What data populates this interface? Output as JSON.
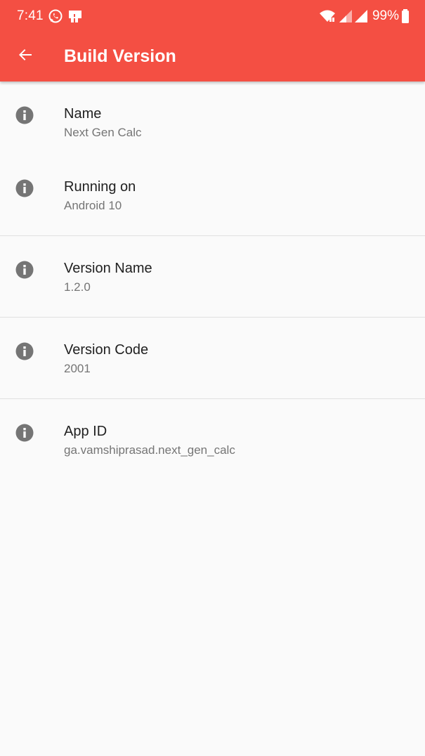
{
  "status_bar": {
    "time": "7:41",
    "battery": "99%",
    "icons": [
      "whatsapp-icon",
      "notification-app-icon",
      "wifi-icon",
      "signal-icon",
      "signal-icon",
      "battery-icon"
    ]
  },
  "app_bar": {
    "title": "Build Version",
    "back_icon": "arrow-back-icon",
    "color": "#f44f43"
  },
  "items": [
    {
      "icon": "info-icon",
      "title": "Name",
      "subtitle": "Next Gen Calc"
    },
    {
      "icon": "info-icon",
      "title": "Running on",
      "subtitle": "Android 10"
    },
    {
      "icon": "info-icon",
      "title": "Version Name",
      "subtitle": "1.2.0"
    },
    {
      "icon": "info-icon",
      "title": "Version Code",
      "subtitle": "2001"
    },
    {
      "icon": "info-icon",
      "title": "App ID",
      "subtitle": "ga.vamshiprasad.next_gen_calc"
    }
  ]
}
